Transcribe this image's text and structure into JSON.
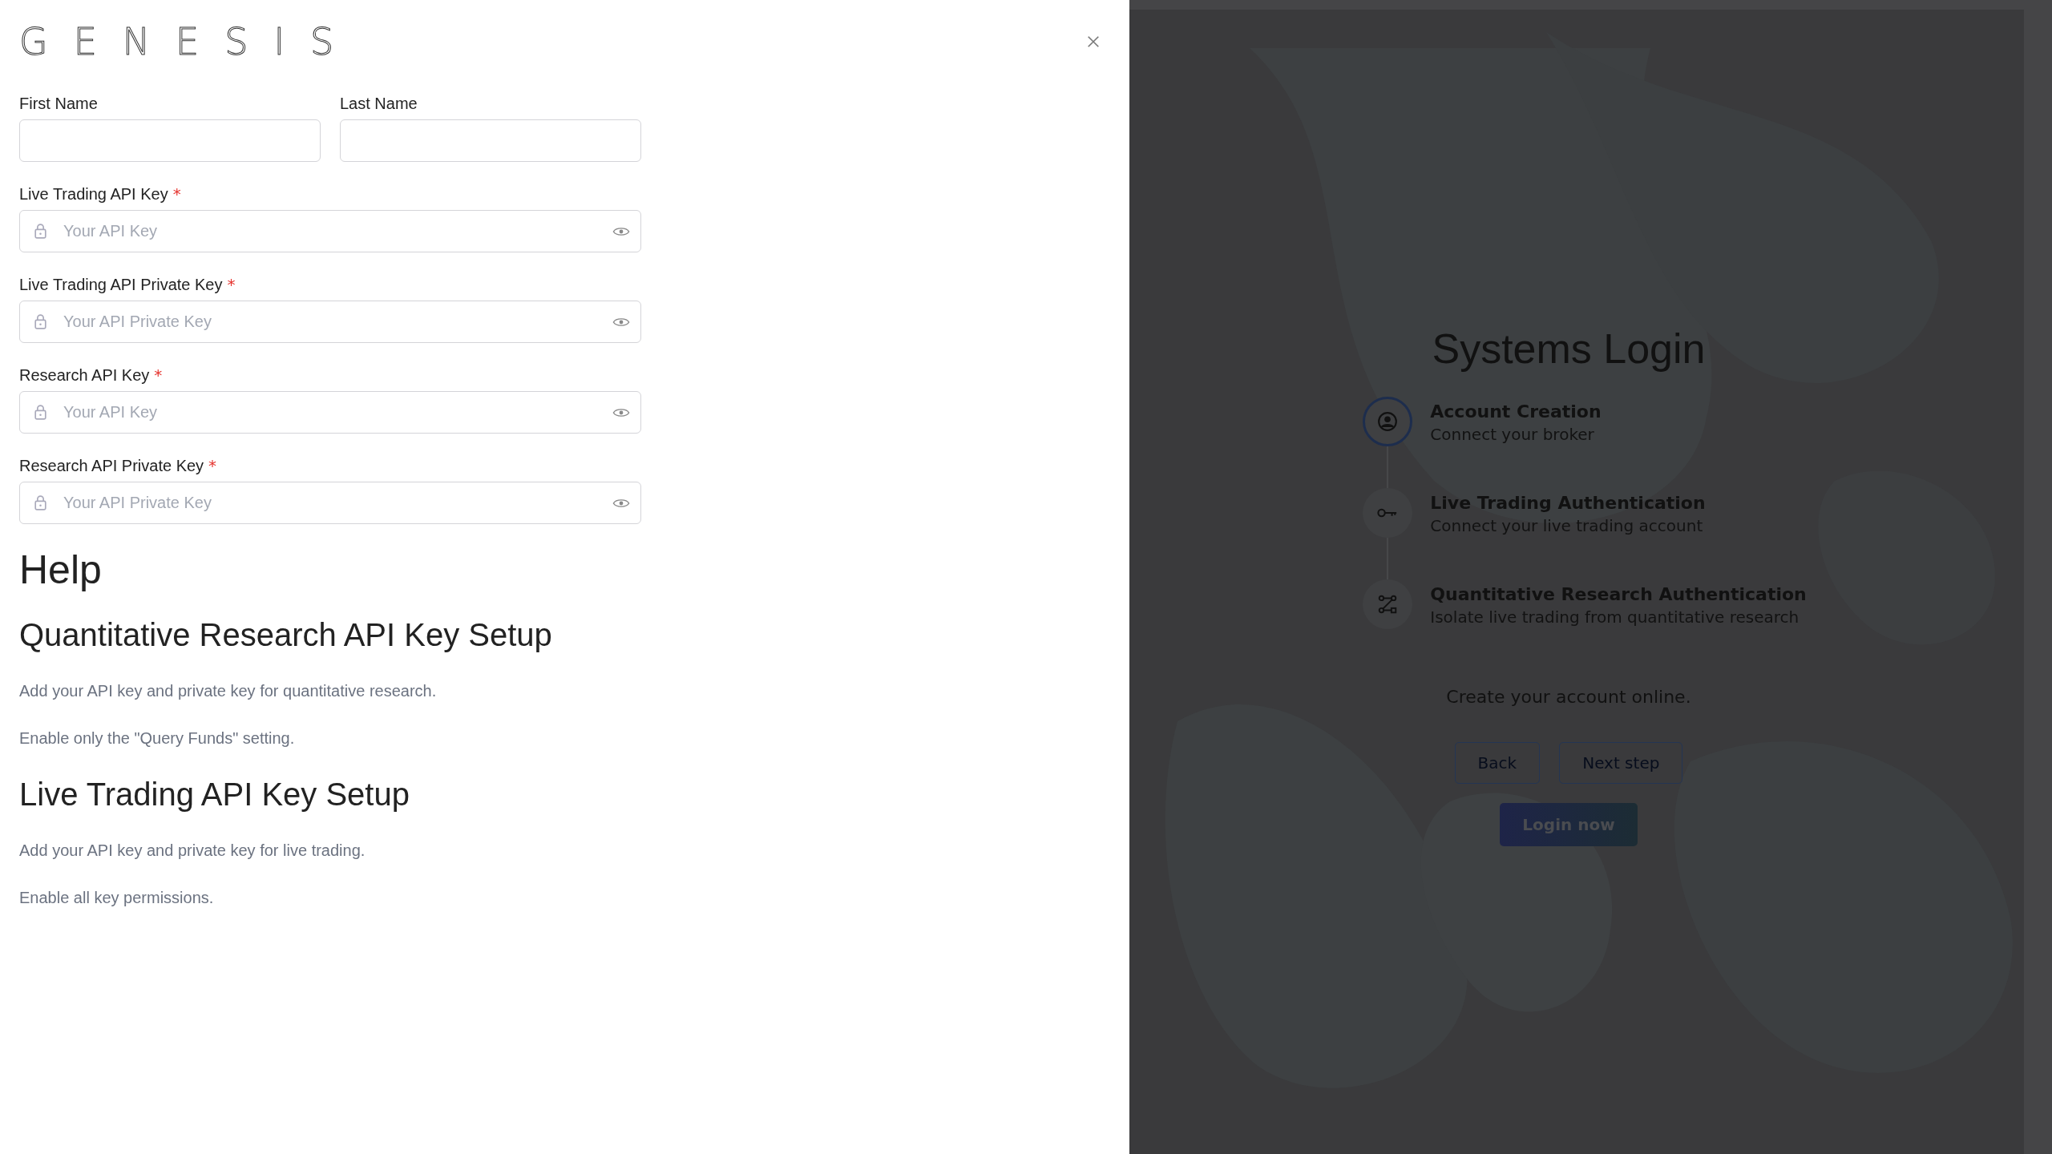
{
  "drawer": {
    "logo": "GENESIS",
    "name_fields": [
      {
        "label": "First Name"
      },
      {
        "label": "Last Name"
      }
    ],
    "key_fields": [
      {
        "label": "Live Trading API Key",
        "required_mark": "*",
        "placeholder": "Your API Key"
      },
      {
        "label": "Live Trading API Private Key",
        "required_mark": "*",
        "placeholder": "Your API Private Key"
      },
      {
        "label": "Research API Key",
        "required_mark": "*",
        "placeholder": "Your API Key"
      },
      {
        "label": "Research API Private Key",
        "required_mark": "*",
        "placeholder": "Your API Private Key"
      }
    ],
    "help": {
      "title": "Help",
      "sections": [
        {
          "heading": "Quantitative Research API Key Setup",
          "paragraphs": [
            "Add your API key and private key for quantitative research.",
            "Enable only the \"Query Funds\" setting."
          ]
        },
        {
          "heading": "Live Trading API Key Setup",
          "paragraphs": [
            "Add your API key and private key for live trading.",
            "Enable all key permissions."
          ]
        }
      ]
    }
  },
  "login": {
    "title": "Systems Login",
    "steps": [
      {
        "kind": "account",
        "title": "Account Creation",
        "description": "Connect your broker",
        "selected": true
      },
      {
        "kind": "key",
        "title": "Live Trading Authentication",
        "description": "Connect your live trading account",
        "selected": false
      },
      {
        "kind": "branch",
        "title": "Quantitative Research Authentication",
        "description": "Isolate live trading from quantitative research",
        "selected": false
      }
    ],
    "message": "Create your account online.",
    "buttons": [
      {
        "label": "Back"
      },
      {
        "label": "Next step"
      }
    ],
    "primary_button": "Login now"
  }
}
